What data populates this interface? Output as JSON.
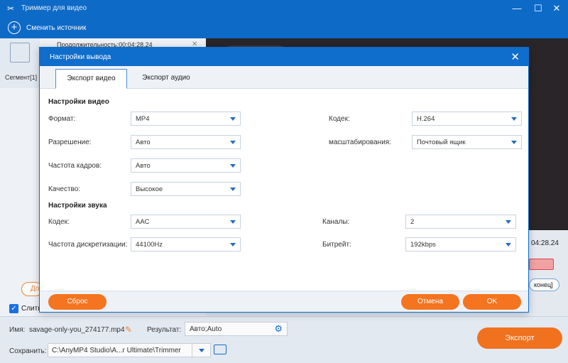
{
  "app": {
    "title": "Триммер для видео"
  },
  "toolbar": {
    "add_source": "Сменить источник"
  },
  "segment": {
    "label": "Сегмент[1]",
    "duration_text": "Продолжительность:00:04:28.24"
  },
  "right": {
    "time": "04:28.24",
    "end_label": "конец]"
  },
  "left": {
    "add_partial": "До",
    "merge_label": "Слить"
  },
  "bottom": {
    "name_label": "Имя:",
    "name_value": "savage-only-you_274177.mp4",
    "result_label": "Результат:",
    "result_value": "Авто;Auto",
    "save_label": "Сохранить:",
    "save_value": "C:\\AnyMP4 Studio\\A...r Ultimate\\Trimmer",
    "export_button": "Экспорт"
  },
  "dialog": {
    "title": "Настройки вывода",
    "tabs": [
      "Экспорт видео",
      "Экспорт аудио"
    ],
    "video_section": "Настройки видео",
    "audio_section": "Настройки звука",
    "video": {
      "format_label": "Формат:",
      "format_value": "MP4",
      "resolution_label": "Разрешение:",
      "resolution_value": "Авто",
      "framerate_label": "Частота кадров:",
      "framerate_value": "Авто",
      "quality_label": "Качество:",
      "quality_value": "Высокое",
      "codec_label": "Кодек:",
      "codec_value": "H.264",
      "scale_label": "масштабирования:",
      "scale_value": "Почтовый ящик"
    },
    "audio": {
      "codec_label": "Кодек:",
      "codec_value": "AAC",
      "samplerate_label": "Частота дискретизации:",
      "samplerate_value": "44100Hz",
      "channels_label": "Каналы:",
      "channels_value": "2",
      "bitrate_label": "Битрейт:",
      "bitrate_value": "192kbps"
    },
    "reset_button": "Сброс",
    "cancel_button": "Отмена",
    "ok_button": "OK"
  },
  "colors": {
    "brand": "#0f6dcb",
    "accent": "#f5741f"
  }
}
